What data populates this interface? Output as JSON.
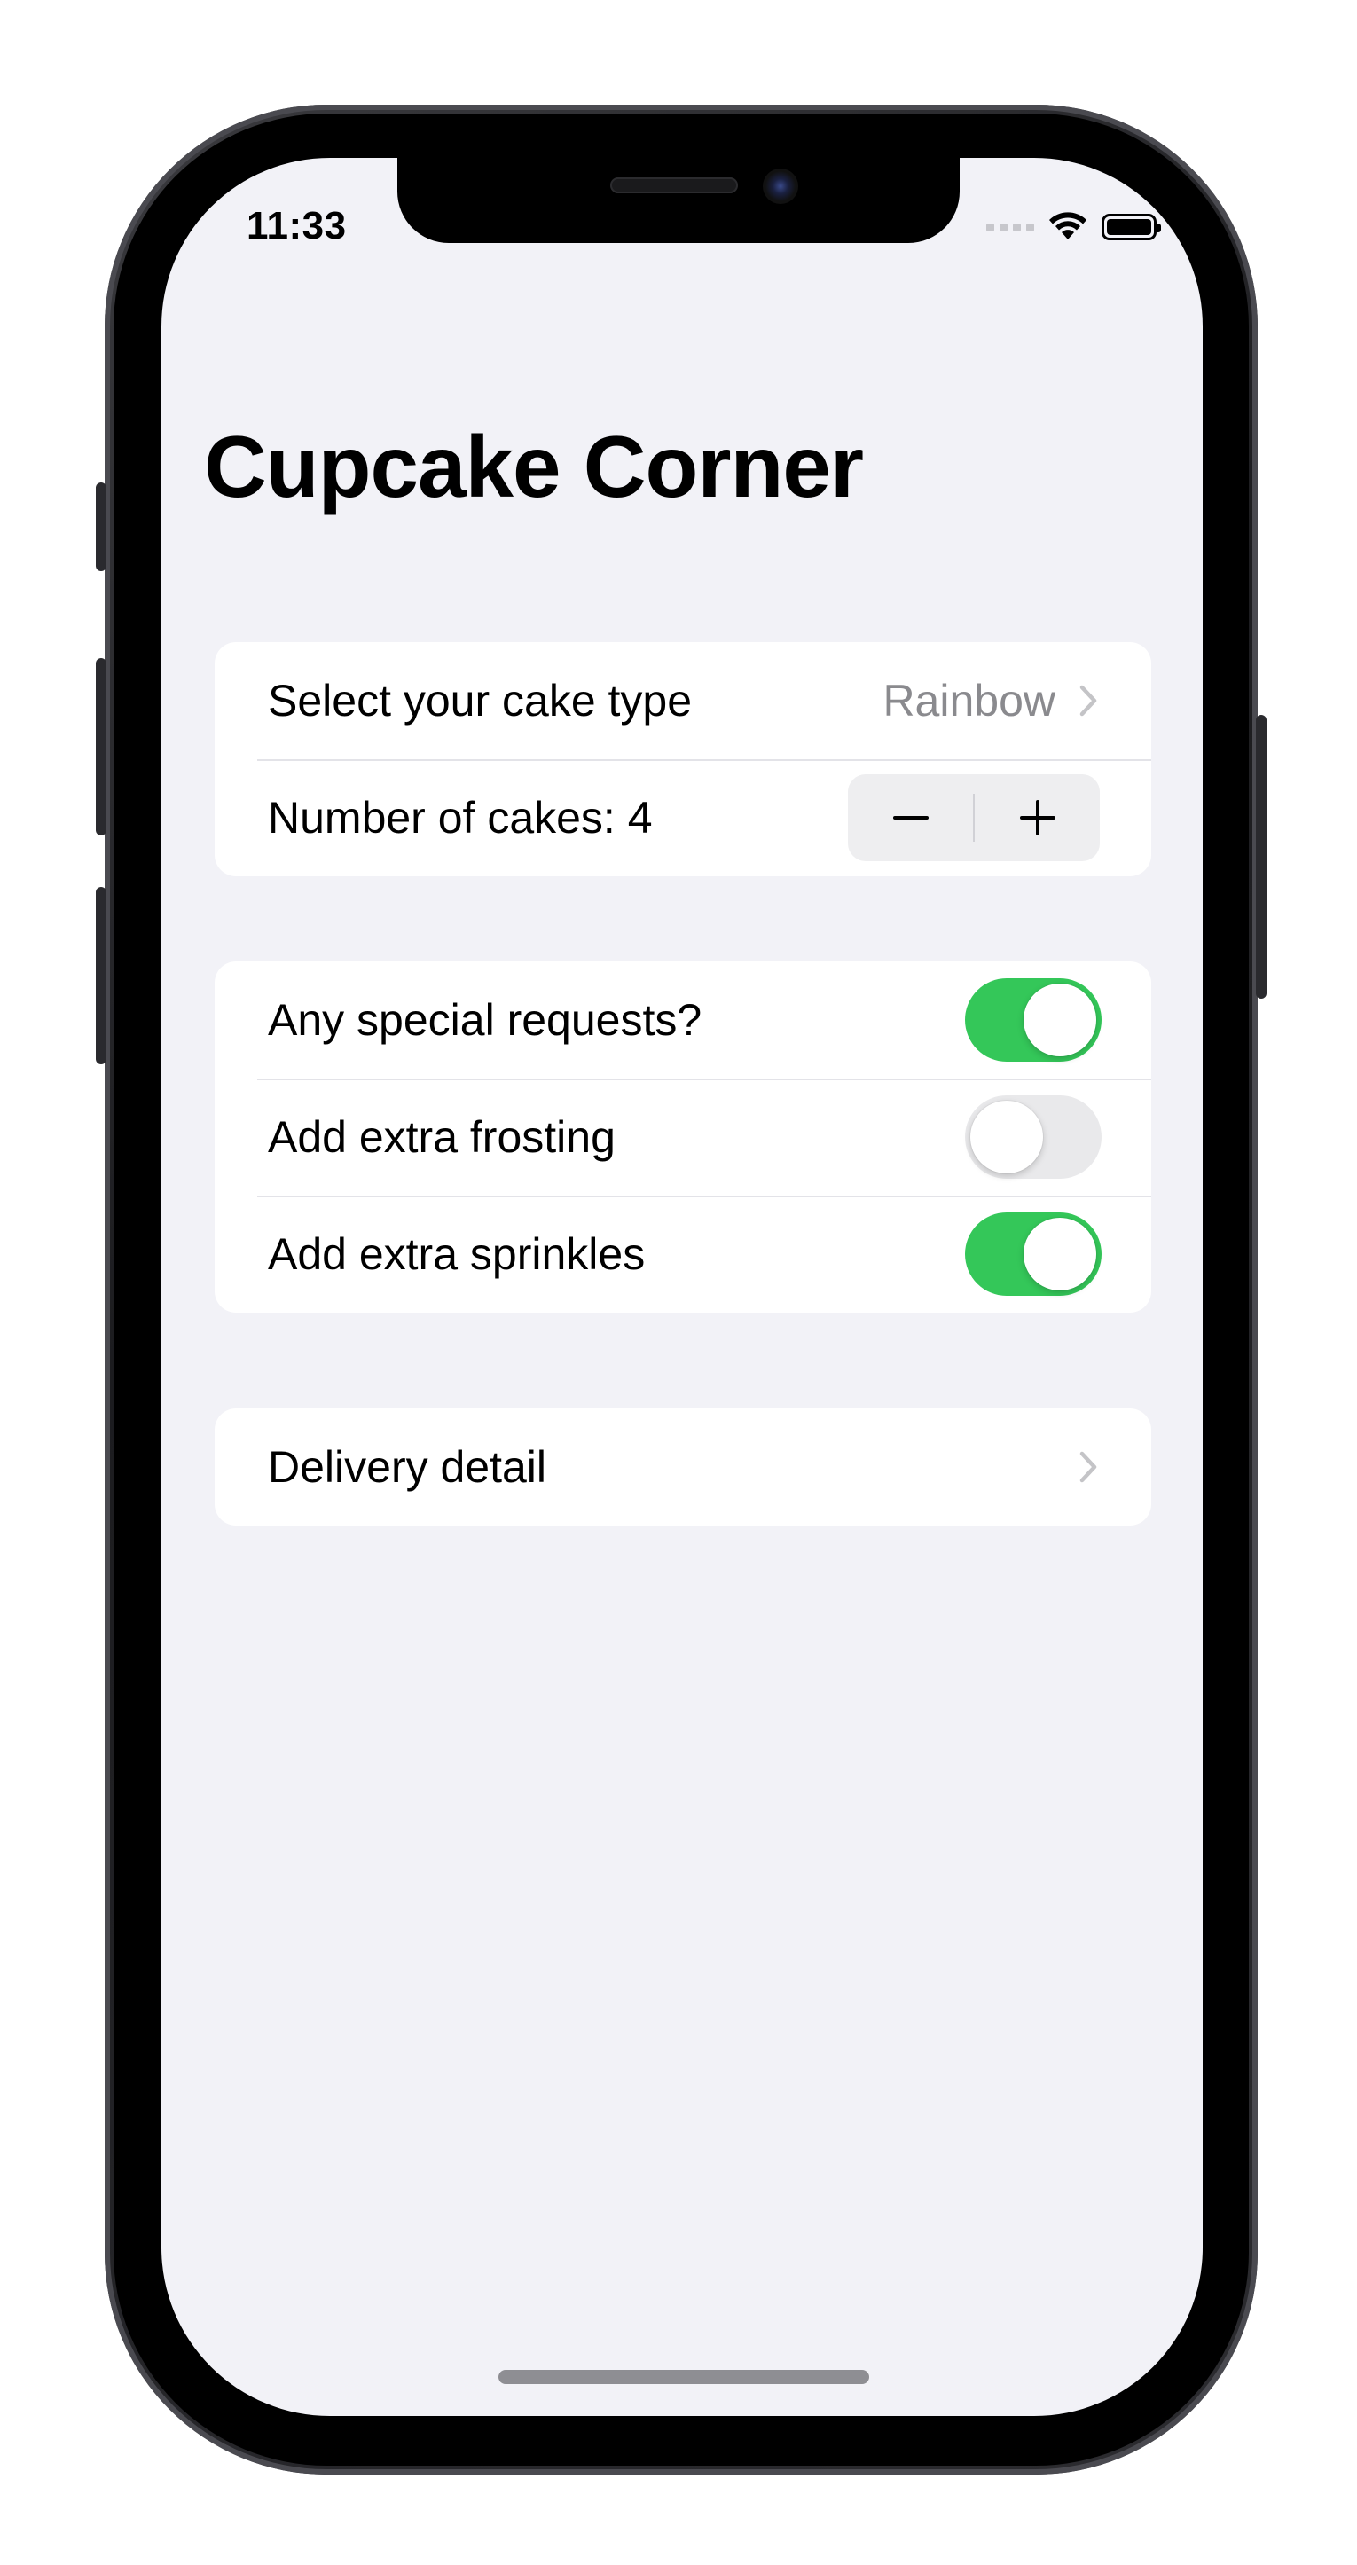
{
  "status_bar": {
    "time": "11:33"
  },
  "screen": {
    "title": "Cupcake Corner",
    "sections": [
      {
        "rows": [
          {
            "label": "Select your cake type",
            "value": "Rainbow"
          },
          {
            "label": "Number of cakes: 4",
            "stepper": {
              "decrement": "−",
              "increment": "+"
            }
          }
        ]
      },
      {
        "rows": [
          {
            "label": "Any special requests?",
            "toggle": true
          },
          {
            "label": "Add extra frosting",
            "toggle": false
          },
          {
            "label": "Add extra sprinkles",
            "toggle": true
          }
        ]
      },
      {
        "rows": [
          {
            "label": "Delivery detail"
          }
        ]
      }
    ]
  },
  "colors": {
    "toggle_on": "#34c759",
    "toggle_off": "#e9e9eb",
    "background": "#f2f2f7",
    "secondary_text": "#8a8a8e"
  },
  "icons": [
    "wifi-icon",
    "battery-icon",
    "cellular-signal-icon",
    "chevron-right-icon",
    "minus-icon",
    "plus-icon"
  ]
}
